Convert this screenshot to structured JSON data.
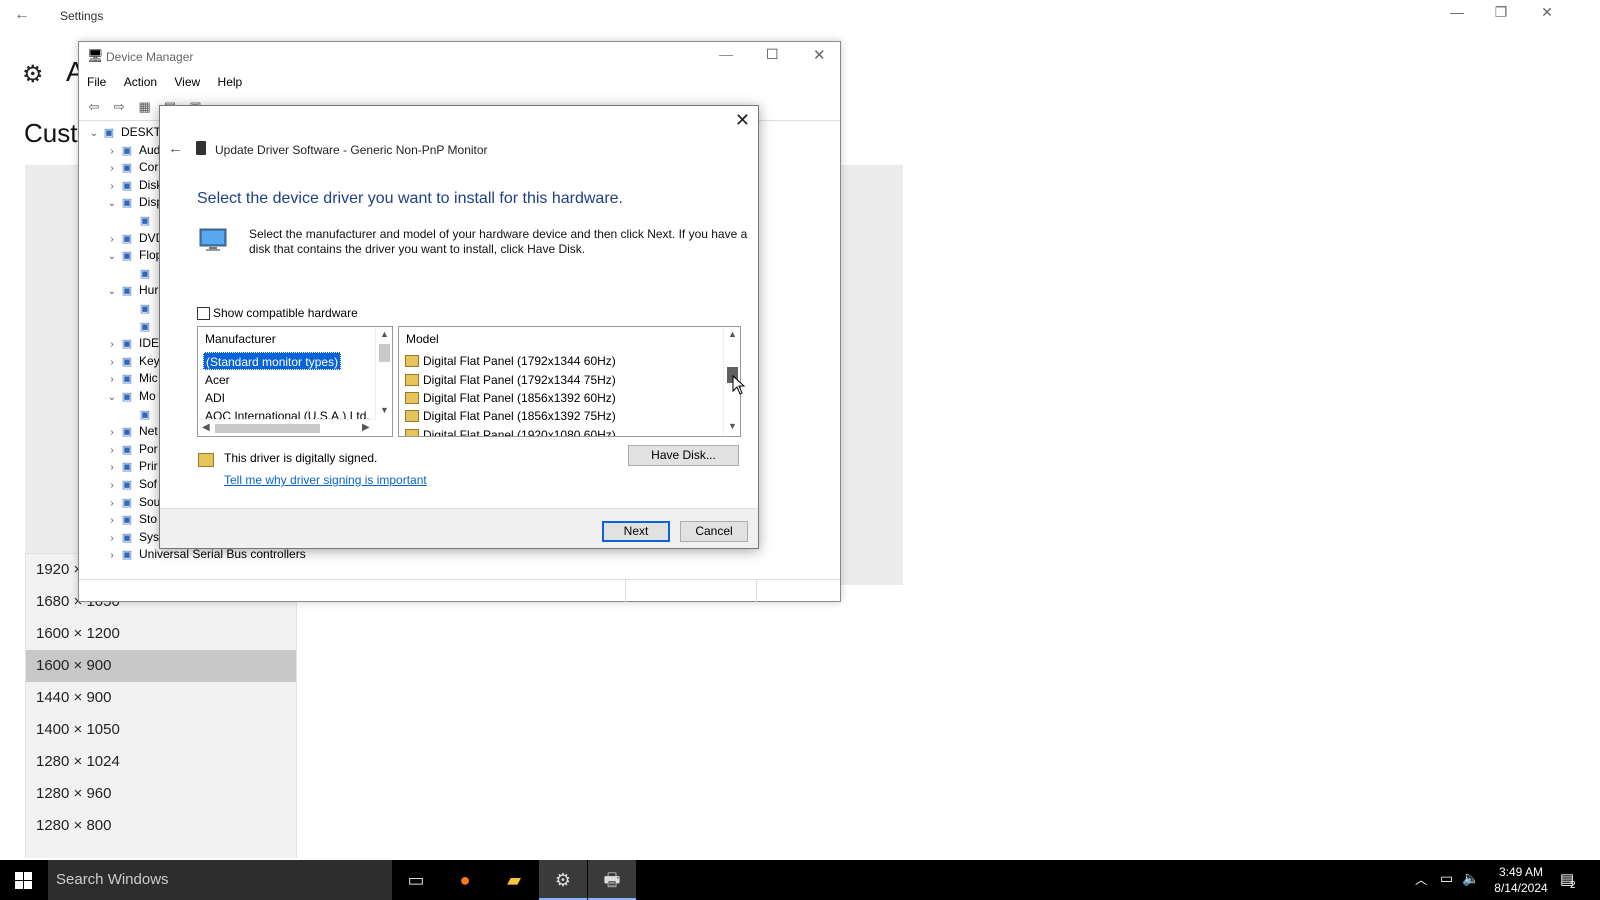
{
  "settings": {
    "title": "Settings",
    "heading": "Custo",
    "letter": "A",
    "resolutions": [
      "1920 ×",
      "1680 × 1050",
      "1600 × 1200",
      "1600 × 900",
      "1440 × 900",
      "1400 × 1050",
      "1280 × 1024",
      "1280 × 960",
      "1280 × 800"
    ],
    "selected_resolution": "1600 × 900"
  },
  "device_manager": {
    "title": "Device Manager",
    "menu": [
      "File",
      "Action",
      "View",
      "Help"
    ],
    "tree": [
      {
        "label": "DESKTO",
        "indent": 0
      },
      {
        "label": "Aud",
        "indent": 1
      },
      {
        "label": "Cor",
        "indent": 1
      },
      {
        "label": "Disk",
        "indent": 1
      },
      {
        "label": "Disp",
        "indent": 1
      },
      {
        "label": "",
        "indent": 2
      },
      {
        "label": "DVD",
        "indent": 1
      },
      {
        "label": "Flop",
        "indent": 1
      },
      {
        "label": "",
        "indent": 2
      },
      {
        "label": "Hur",
        "indent": 1
      },
      {
        "label": "",
        "indent": 2
      },
      {
        "label": "",
        "indent": 2
      },
      {
        "label": "IDE",
        "indent": 1
      },
      {
        "label": "Key",
        "indent": 1
      },
      {
        "label": "Mic",
        "indent": 1
      },
      {
        "label": "Mo",
        "indent": 1
      },
      {
        "label": "",
        "indent": 2
      },
      {
        "label": "Net",
        "indent": 1
      },
      {
        "label": "Por",
        "indent": 1
      },
      {
        "label": "Prir",
        "indent": 1
      },
      {
        "label": "Sof",
        "indent": 1
      },
      {
        "label": "Sou",
        "indent": 1
      },
      {
        "label": "Sto",
        "indent": 1
      },
      {
        "label": "Sys",
        "indent": 1
      },
      {
        "label": "Universal Serial Bus controllers",
        "indent": 1
      }
    ]
  },
  "dialog": {
    "title": "Update Driver Software - Generic Non-PnP Monitor",
    "heading": "Select the device driver you want to install for this hardware.",
    "description": "Select the manufacturer and model of your hardware device and then click Next. If you have a disk that contains the driver you want to install, click Have Disk.",
    "show_compatible_label": "Show compatible hardware",
    "show_compatible_checked": false,
    "manufacturer_header": "Manufacturer",
    "manufacturers": [
      "(Standard monitor types)",
      "Acer",
      "ADI",
      "AOC International (U.S.A.) Ltd."
    ],
    "selected_manufacturer": "(Standard monitor types)",
    "model_header": "Model",
    "models": [
      "Digital Flat Panel (1792x1344 60Hz)",
      "Digital Flat Panel (1792x1344 75Hz)",
      "Digital Flat Panel (1856x1392 60Hz)",
      "Digital Flat Panel (1856x1392 75Hz)",
      "Digital Flat Panel (1920x1080 60Hz)"
    ],
    "signed_text": "This driver is digitally signed.",
    "signing_link": "Tell me why driver signing is important",
    "have_disk_label": "Have Disk...",
    "next_label": "Next",
    "cancel_label": "Cancel"
  },
  "taskbar": {
    "search_placeholder": "Search Windows",
    "time": "3:49 AM",
    "date": "8/14/2024",
    "notification_count": "2"
  }
}
